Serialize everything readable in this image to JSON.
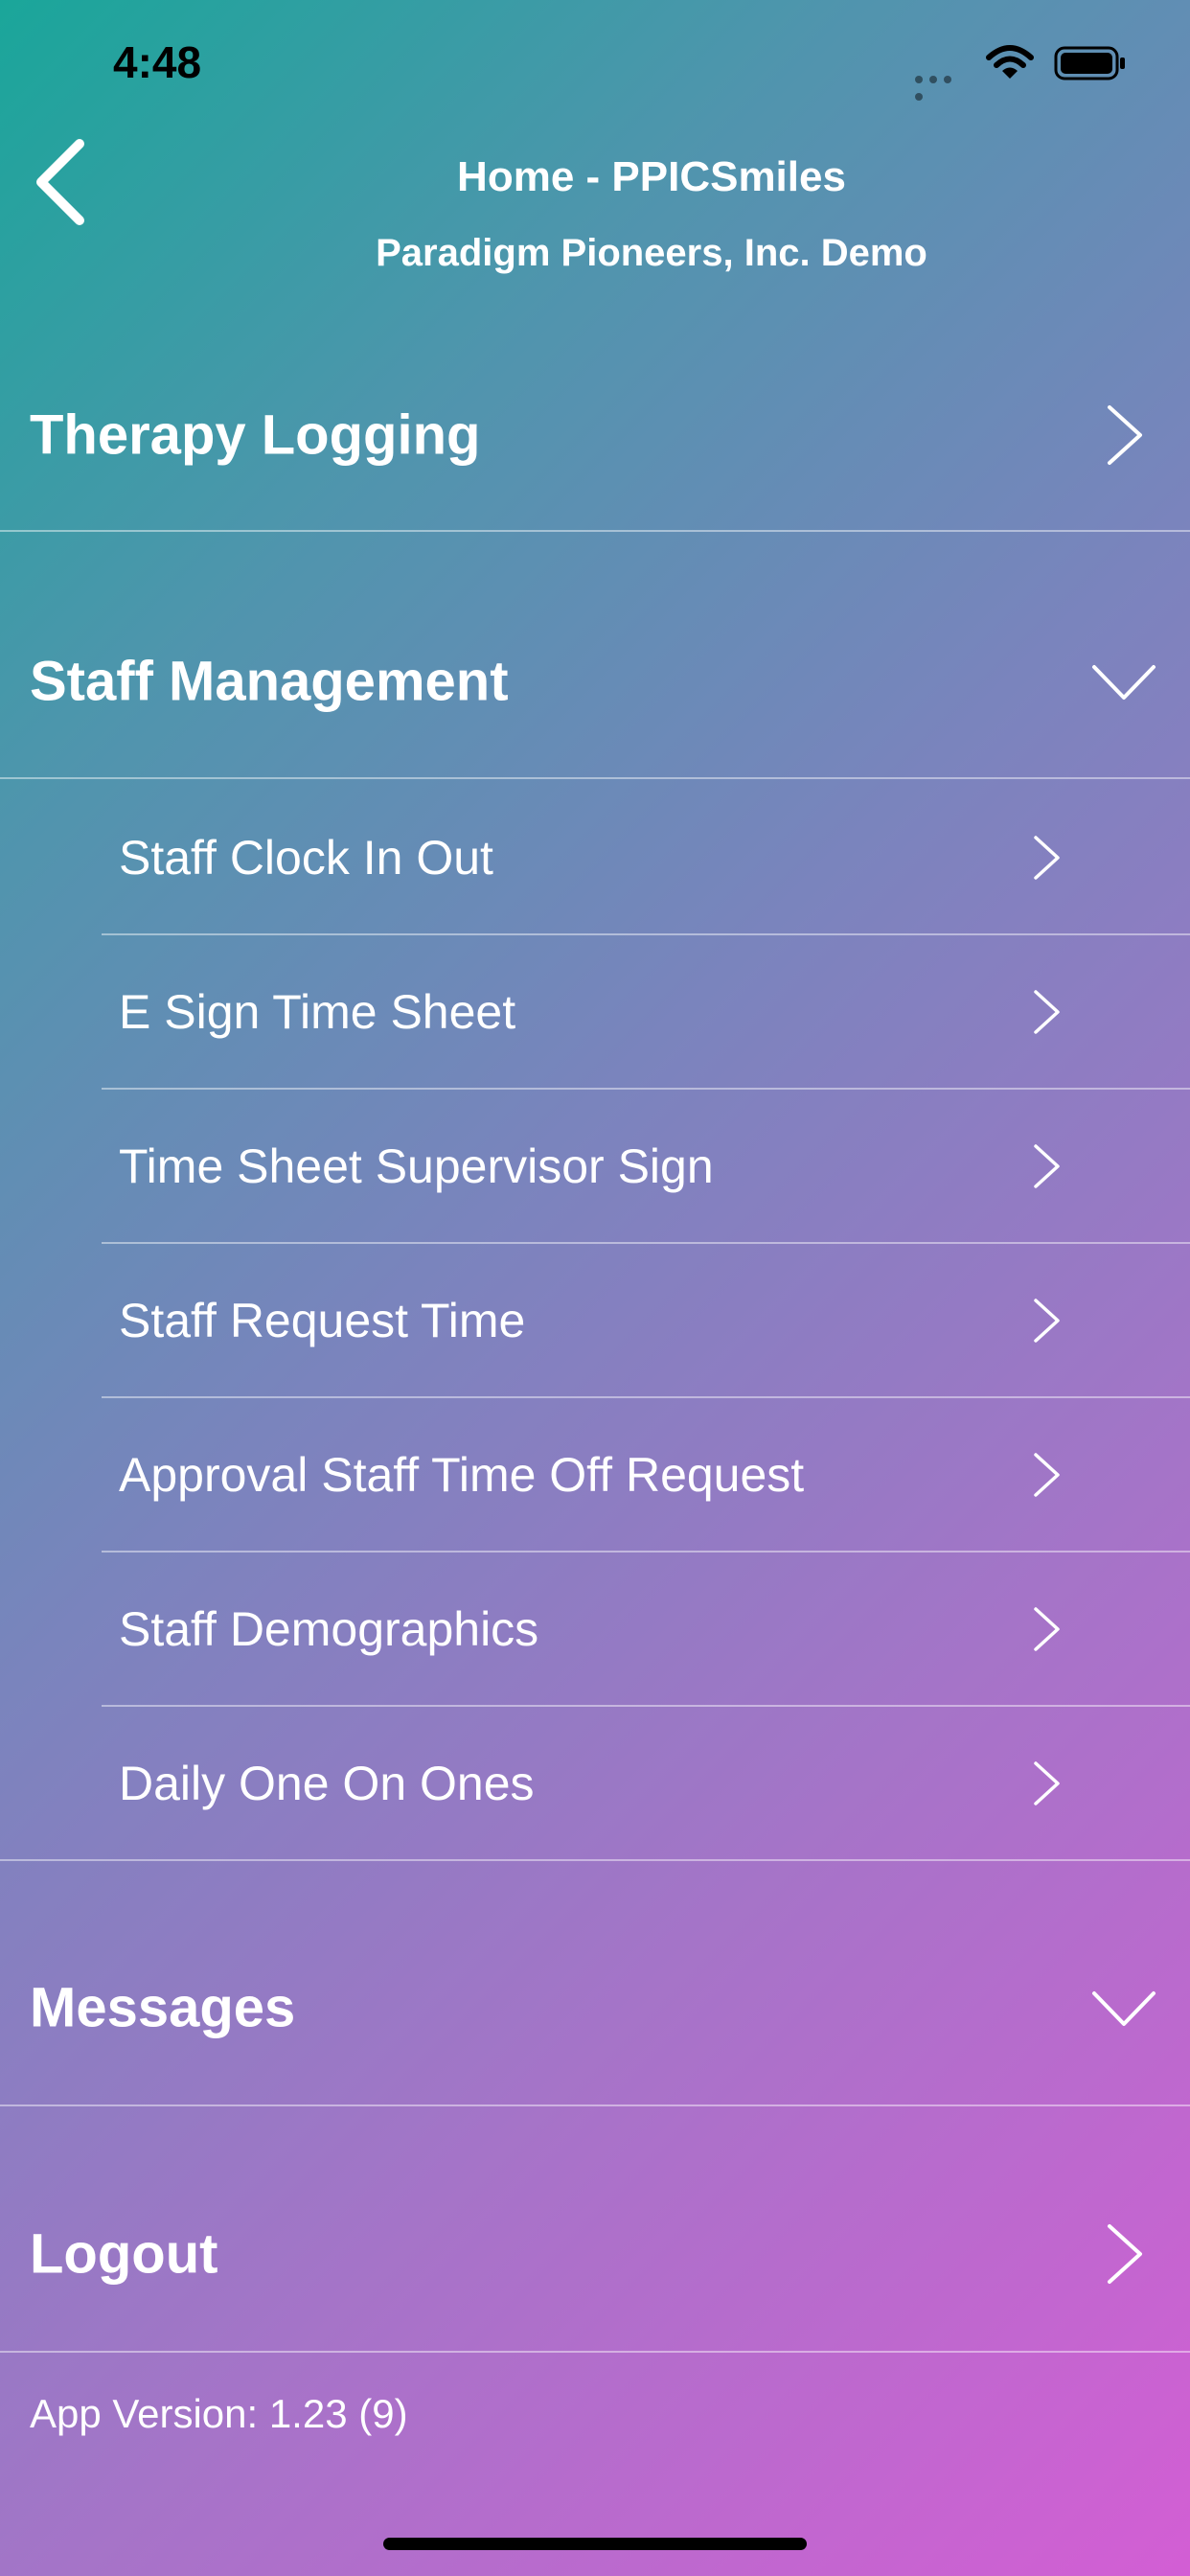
{
  "status_bar": {
    "time": "4:48"
  },
  "header": {
    "title": "Home - PPICSmiles",
    "subtitle": "Paradigm Pioneers, Inc. Demo",
    "back_icon": "chevron-left-icon"
  },
  "sections": {
    "therapy": {
      "label": "Therapy Logging",
      "icon": "chevron-right-icon",
      "expanded": false
    },
    "staff": {
      "label": "Staff Management",
      "icon": "chevron-down-icon",
      "expanded": true
    },
    "messages": {
      "label": "Messages",
      "icon": "chevron-down-icon",
      "expanded": false
    },
    "logout": {
      "label": "Logout",
      "icon": "chevron-right-icon"
    }
  },
  "staff_items": [
    {
      "label": "Staff Clock In Out"
    },
    {
      "label": "E Sign Time Sheet"
    },
    {
      "label": "Time Sheet Supervisor Sign"
    },
    {
      "label": "Staff Request Time"
    },
    {
      "label": "Approval Staff Time Off Request"
    },
    {
      "label": "Staff Demographics"
    },
    {
      "label": "Daily One On Ones"
    }
  ],
  "footer": {
    "version": "App Version: 1.23 (9)"
  },
  "colors": {
    "gradient_start": "#1aa69a",
    "gradient_end": "#d35ed4",
    "text": "#ffffff"
  }
}
